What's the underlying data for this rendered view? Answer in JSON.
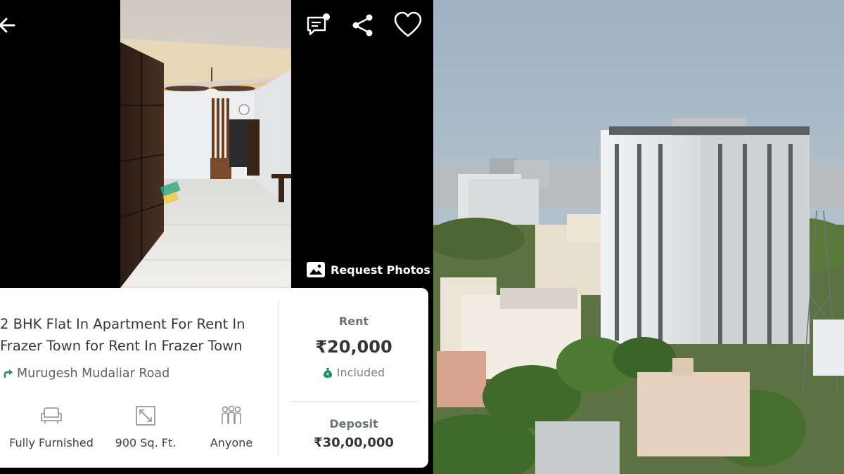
{
  "listing": {
    "title": "2 BHK Flat In Apartment For Rent In Frazer Town for Rent In Frazer Town",
    "location": "Murugesh Mudaliar Road",
    "features": [
      {
        "icon": "sofa-icon",
        "label": "Fully Furnished"
      },
      {
        "icon": "area-expand-icon",
        "label": "900 Sq. Ft."
      },
      {
        "icon": "people-icon",
        "label": "Anyone"
      }
    ],
    "rent": {
      "label": "Rent",
      "value": "₹20,000",
      "note": "Included"
    },
    "deposit": {
      "label": "Deposit",
      "value": "₹30,00,000"
    }
  },
  "photo_actions": {
    "request_photos_label": "Request Photos"
  },
  "toolbar": {
    "icons": [
      "back-arrow-icon",
      "chat-icon",
      "share-icon",
      "heart-icon"
    ]
  },
  "colors": {
    "text_dark": "#33363b",
    "text_muted": "#6c737a",
    "accent_green": "#1c8c6c"
  }
}
